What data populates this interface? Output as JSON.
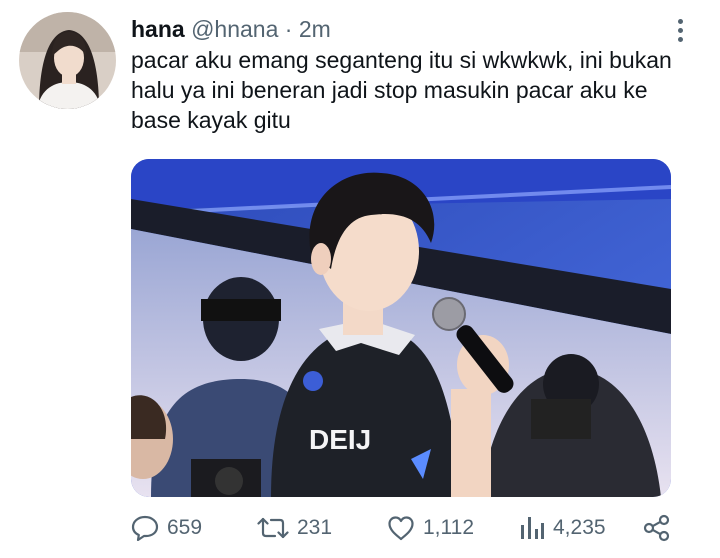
{
  "tweet": {
    "author": {
      "name": "hana",
      "handle": "@hnana",
      "separator": "·",
      "time": "2m"
    },
    "text": "pacar aku emang seganteng itu si wkwkwk, ini bukan halu ya ini beneran jadi stop masukin pacar aku ke base kayak gitu",
    "media": {
      "jersey_text": "DEIJ"
    },
    "stats": {
      "replies": "659",
      "retweets": "231",
      "likes": "1,112",
      "views": "4,235"
    }
  },
  "icons": {
    "more": "more-vertical-icon",
    "reply": "reply-icon",
    "retweet": "retweet-icon",
    "like": "heart-icon",
    "views": "views-icon",
    "share": "share-icon"
  },
  "colors": {
    "text": "#0f1419",
    "secondary": "#536471",
    "background": "#ffffff"
  }
}
